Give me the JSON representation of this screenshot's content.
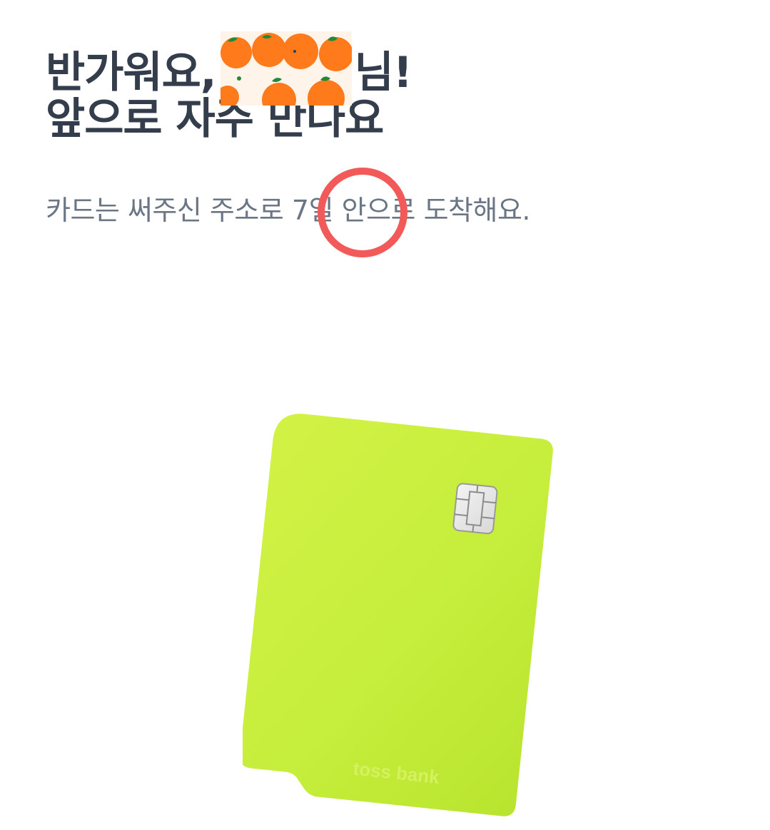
{
  "greeting": {
    "prefix": "반가워요,",
    "suffix": "님!",
    "line2": "앞으로 자주 만나요",
    "name_mask": "orange-pattern-sticker"
  },
  "delivery": {
    "before": "카드는 써주신 주소로 ",
    "days": "7일",
    "after": " 안으로 도착해요."
  },
  "annotation": {
    "shape": "circle",
    "color": "#f25a5a"
  },
  "card": {
    "brand": "toss bank",
    "color": "#c8ee3a",
    "chip_icon": "chip-icon"
  },
  "colors": {
    "heading": "#333d4b",
    "body": "#6b7684",
    "orange": "#ff7a1a",
    "leaf": "#1f8a3a"
  }
}
